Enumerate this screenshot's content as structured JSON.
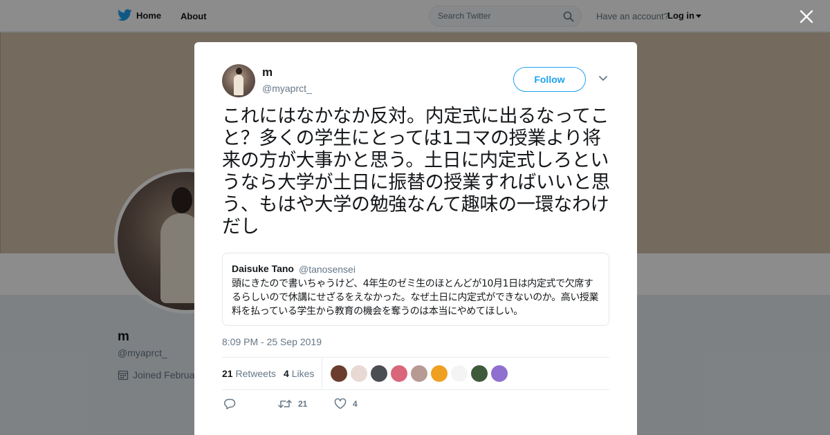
{
  "topbar": {
    "home_label": "Home",
    "about_label": "About",
    "search_placeholder": "Search Twitter",
    "account_prompt": "Have an account?",
    "login_label": "Log in"
  },
  "profile": {
    "name": "m",
    "handle": "@myaprct_",
    "joined_text": "Joined Februa"
  },
  "tweet": {
    "author_name": "m",
    "author_handle": "@myaprct_",
    "follow_label": "Follow",
    "text": "これにはなかなか反対。内定式に出るなってこと？多くの学生にとっては1コマの授業より将来の方が大事かと思う。土日に内定式しろというなら大学が土日に振替の授業すればいいと思う、もはや大学の勉強なんて趣味の一環なわけだし",
    "quoted": {
      "name": "Daisuke Tano",
      "handle": "@tanosensei",
      "text": "頭にきたので書いちゃうけど、4年生のゼミ生のほとんどが10月1日は内定式で欠席するらしいので休講にせざるをえなかった。なぜ土日に内定式ができないのか。高い授業料を払っている学生から教育の機会を奪うのは本当にやめてほしい。"
    },
    "timestamp": "8:09 PM - 25 Sep 2019",
    "stats": {
      "retweets_count": "21",
      "retweets_label": "Retweets",
      "likes_count": "4",
      "likes_label": "Likes"
    },
    "actions": {
      "retweet_count": "21",
      "like_count": "4"
    }
  },
  "colors": {
    "brand": "#1da1f2",
    "secondary_text": "#657786"
  },
  "liker_avatars": [
    "#6b3d2e",
    "#e8d9d4",
    "#4a4e52",
    "#d9667a",
    "#b89a95",
    "#f0a020",
    "#f4f4f4",
    "#3e5a3a",
    "#8f6fd0"
  ]
}
